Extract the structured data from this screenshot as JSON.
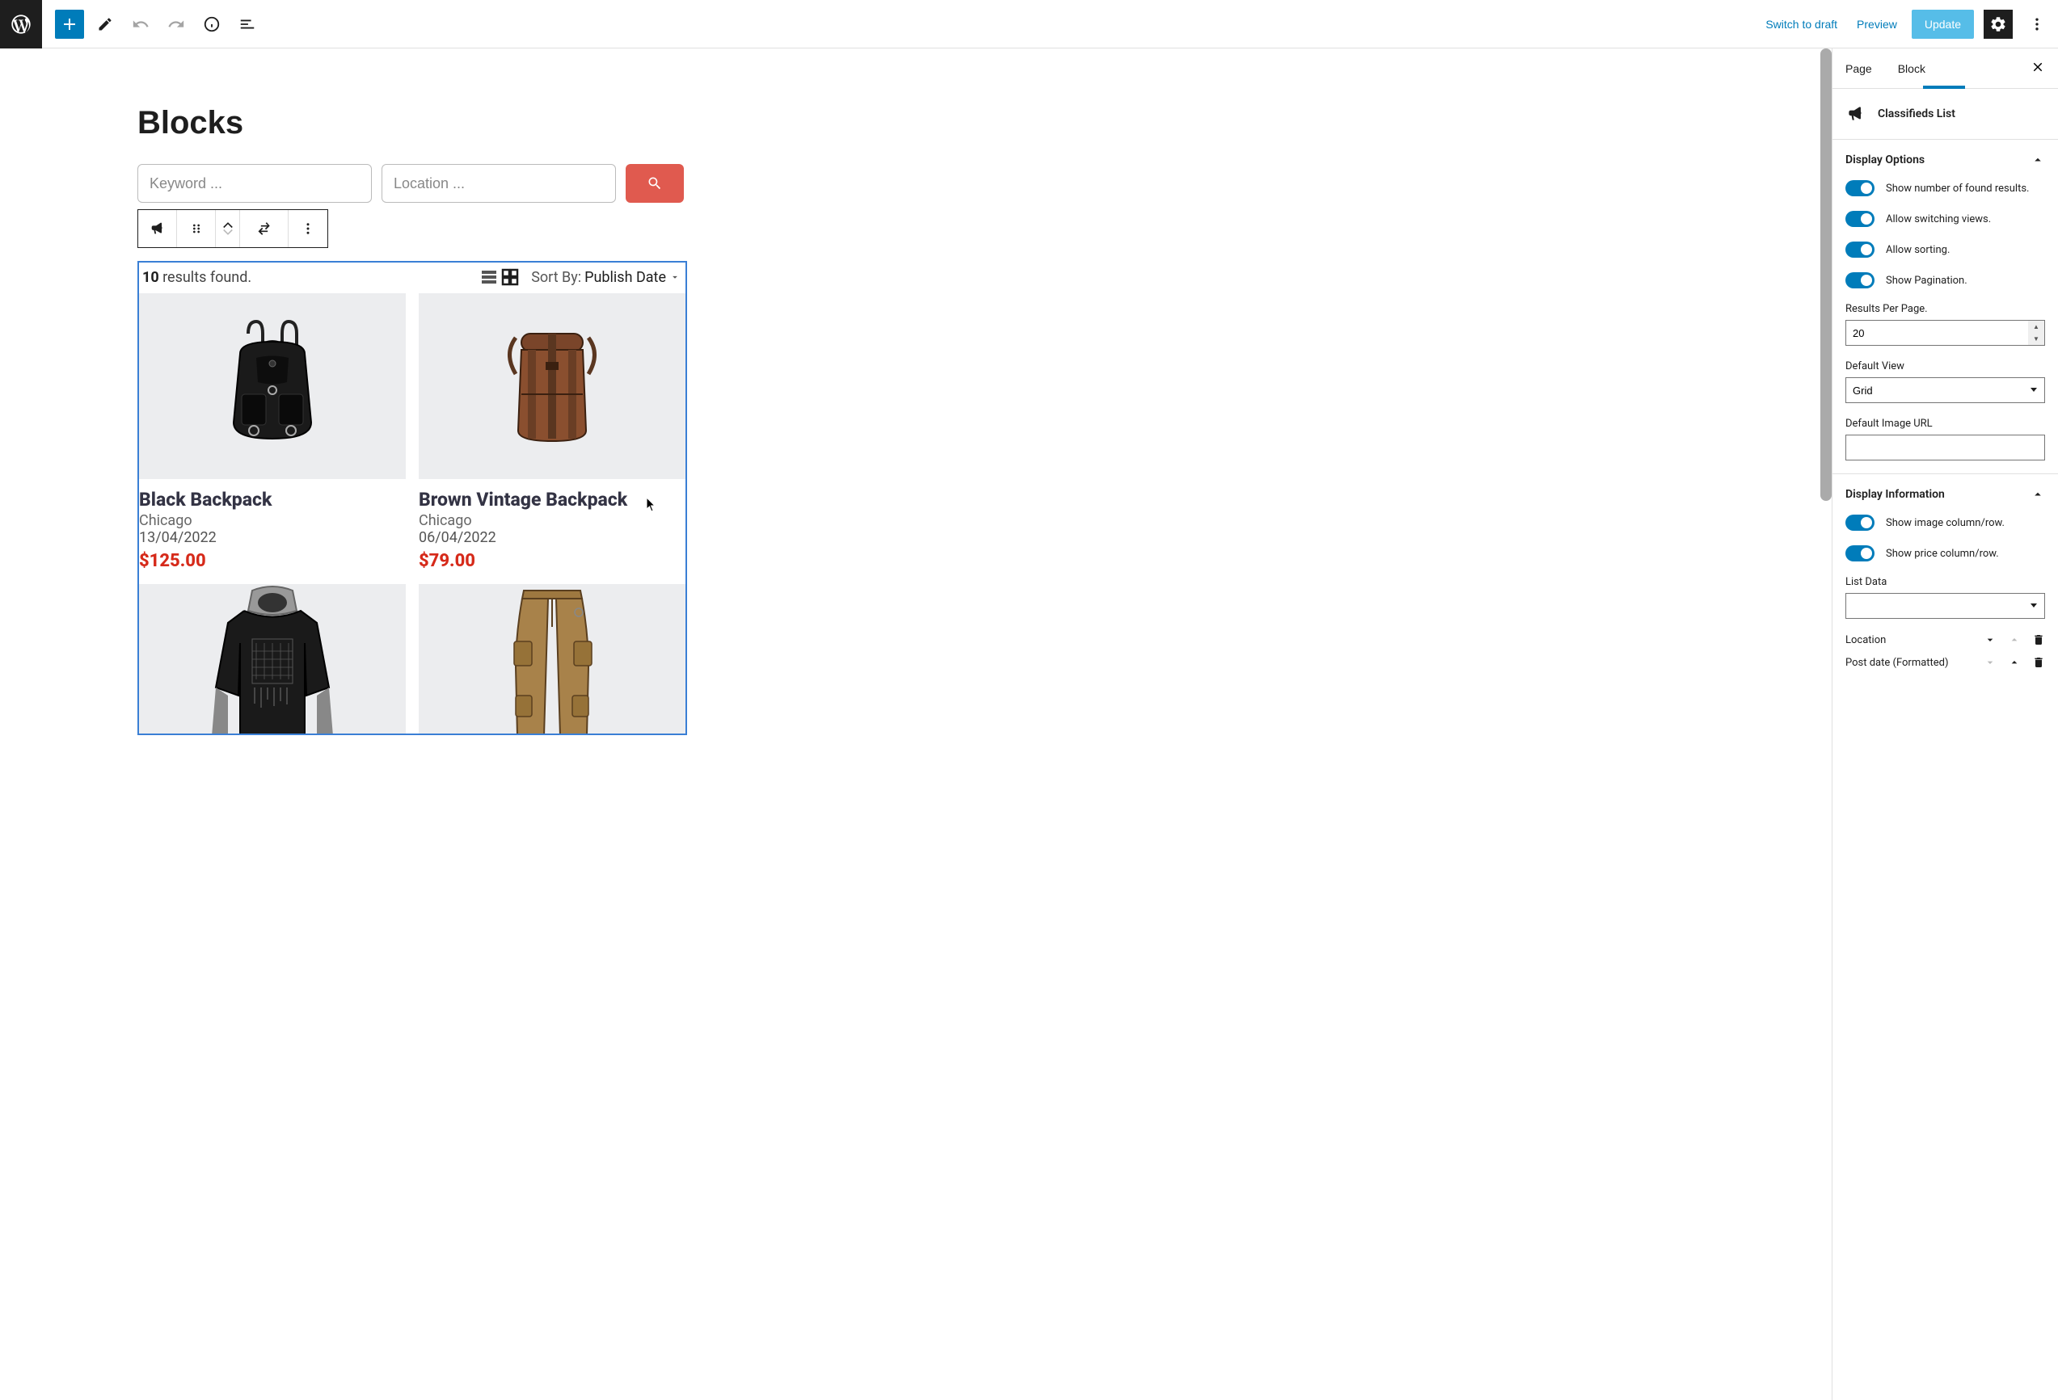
{
  "toolbar": {
    "switch_draft": "Switch to draft",
    "preview": "Preview",
    "update": "Update"
  },
  "page_title": "Blocks",
  "search": {
    "keyword_placeholder": "Keyword ...",
    "location_placeholder": "Location ..."
  },
  "results": {
    "count": "10",
    "count_suffix": " results found.",
    "sort_label": "Sort By: ",
    "sort_value": "Publish Date",
    "items": [
      {
        "title": "Black Backpack",
        "location": "Chicago",
        "date": "13/04/2022",
        "price": "$125.00",
        "img": "black-backpack"
      },
      {
        "title": "Brown Vintage Backpack",
        "location": "Chicago",
        "date": "06/04/2022",
        "price": "$79.00",
        "img": "brown-backpack"
      },
      {
        "title": "",
        "location": "",
        "date": "",
        "price": "",
        "img": "black-hoodie"
      },
      {
        "title": "",
        "location": "",
        "date": "",
        "price": "",
        "img": "cargo-pants"
      }
    ]
  },
  "sidebar": {
    "tabs": {
      "page": "Page",
      "block": "Block"
    },
    "block_name": "Classifieds List",
    "panels": {
      "display_options": {
        "title": "Display Options",
        "toggles": {
          "show_results": "Show number of found results.",
          "allow_views": "Allow switching views.",
          "allow_sorting": "Allow sorting.",
          "show_pagination": "Show Pagination."
        },
        "results_per_page_label": "Results Per Page.",
        "results_per_page_value": "20",
        "default_view_label": "Default View",
        "default_view_value": "Grid",
        "default_image_label": "Default Image URL",
        "default_image_value": ""
      },
      "display_info": {
        "title": "Display Information",
        "toggles": {
          "show_image": "Show image column/row.",
          "show_price": "Show price column/row."
        },
        "list_data_label": "List Data",
        "list_data_value": "",
        "rows": [
          {
            "label": "Location"
          },
          {
            "label": "Post date (Formatted)"
          }
        ]
      }
    }
  }
}
